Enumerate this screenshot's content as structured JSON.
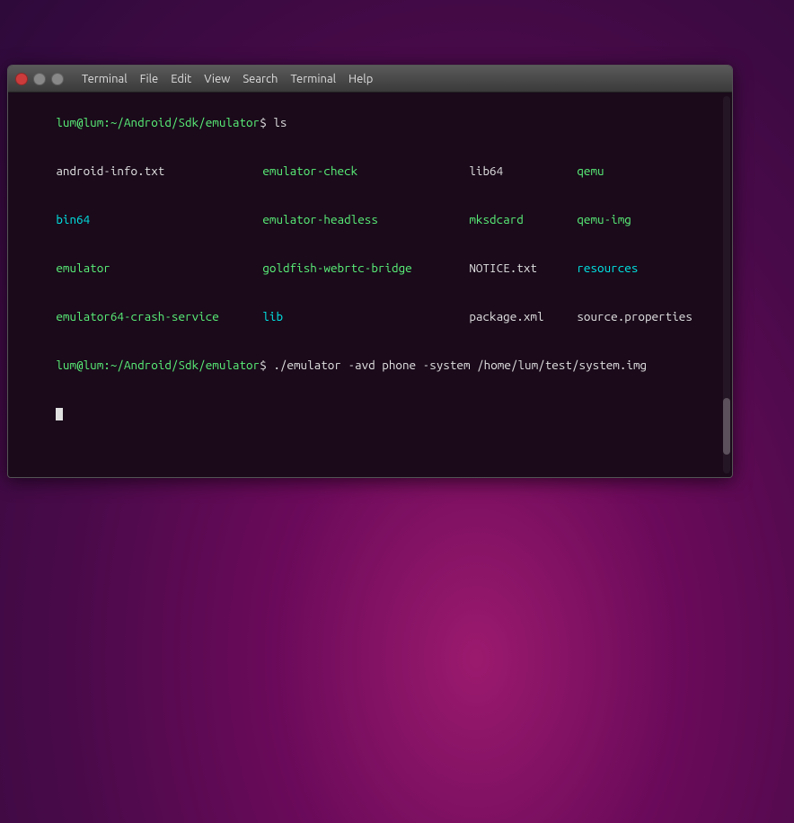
{
  "desktop": {
    "background_colors": [
      "#9b1a6e",
      "#6b0a5a",
      "#4a0a4a",
      "#2d0a3a"
    ]
  },
  "window": {
    "title": "Terminal",
    "titlebar": {
      "close_label": "",
      "minimize_label": "",
      "maximize_label": ""
    },
    "menu": {
      "items": [
        "Terminal",
        "File",
        "Edit",
        "View",
        "Search",
        "Terminal",
        "Help"
      ]
    }
  },
  "terminal": {
    "lines": [
      {
        "type": "prompt_cmd",
        "prompt": "lum@lum:~/Android/Sdk/emulator",
        "dollar": "$ ",
        "command": "ls"
      },
      {
        "type": "ls_output",
        "files": [
          {
            "name": "android-info.txt",
            "color": "white"
          },
          {
            "name": "emulator-check",
            "color": "green"
          },
          {
            "name": "lib64",
            "color": "white"
          },
          {
            "name": "qemu",
            "color": "green"
          },
          {
            "name": "bin64",
            "color": "cyan"
          },
          {
            "name": "emulator-headless",
            "color": "green"
          },
          {
            "name": "mksdcard",
            "color": "green"
          },
          {
            "name": "qemu-img",
            "color": "green"
          },
          {
            "name": "emulator",
            "color": "green"
          },
          {
            "name": "goldfish-webrtc-bridge",
            "color": "green"
          },
          {
            "name": "NOTICE.txt",
            "color": "white"
          },
          {
            "name": "resources",
            "color": "cyan"
          },
          {
            "name": "emulator64-crash-service",
            "color": "green"
          },
          {
            "name": "lib",
            "color": "cyan"
          },
          {
            "name": "package.xml",
            "color": "white"
          },
          {
            "name": "source.properties",
            "color": "white"
          }
        ]
      },
      {
        "type": "prompt_cmd",
        "prompt": "lum@lum:~/Android/Sdk/emulator",
        "dollar": "$ ",
        "command": "./emulator -avd phone -system /home/lum/test/system.img"
      },
      {
        "type": "cursor"
      }
    ],
    "ls_rows": [
      [
        "android-info.txt",
        "emulator-check",
        "lib64",
        "qemu"
      ],
      [
        "bin64",
        "emulator-headless",
        "mksdcard",
        "qemu-img"
      ],
      [
        "emulator",
        "goldfish-webrtc-bridge",
        "NOTICE.txt",
        "resources"
      ],
      [
        "emulator64-crash-service",
        "lib",
        "package.xml",
        "source.properties"
      ]
    ],
    "prompt1": "lum@lum:~/Android/Sdk/emulator",
    "cmd1": "ls",
    "prompt2": "lum@lum:~/Android/Sdk/emulator",
    "cmd2": "./emulator -avd phone -system /home/lum/test/system.img"
  }
}
